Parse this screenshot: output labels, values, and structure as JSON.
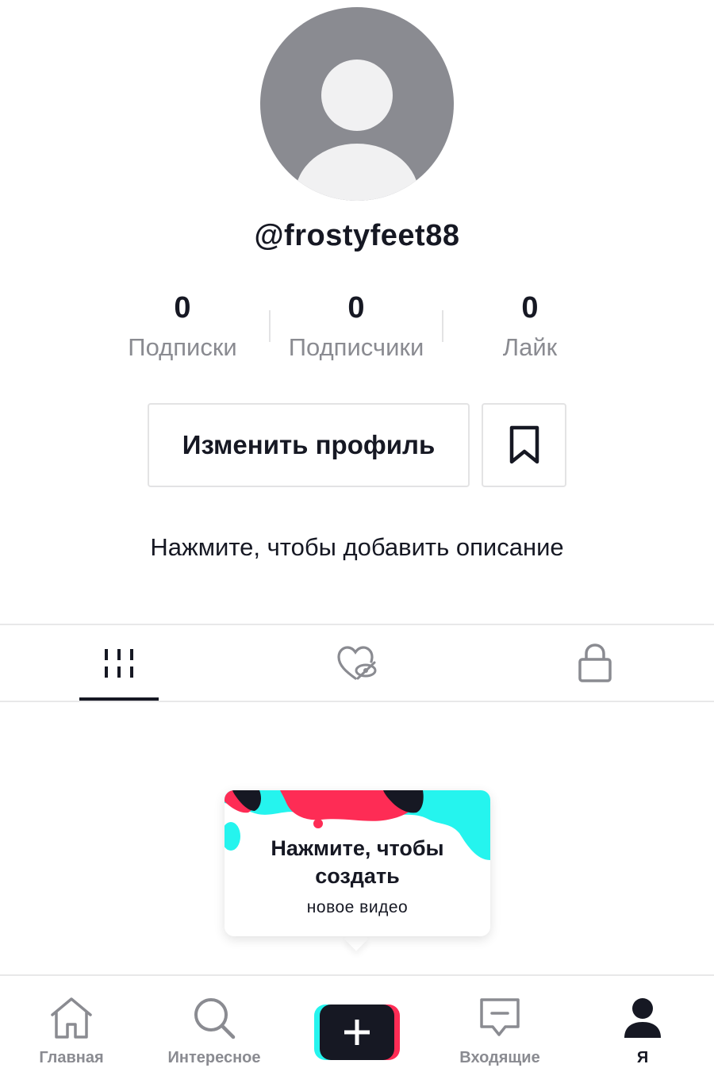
{
  "profile": {
    "username": "@frostyfeet88",
    "bio_placeholder": "Нажмите, чтобы добавить описание"
  },
  "stats": [
    {
      "value": "0",
      "label": "Подписки"
    },
    {
      "value": "0",
      "label": "Подписчики"
    },
    {
      "value": "0",
      "label": "Лайк"
    }
  ],
  "actions": {
    "edit_profile_label": "Изменить профиль",
    "bookmark_icon": "bookmark-icon"
  },
  "tabs": [
    {
      "icon": "grid-icon",
      "active": true
    },
    {
      "icon": "liked-hidden-icon",
      "active": false
    },
    {
      "icon": "lock-icon",
      "active": false
    }
  ],
  "create_tooltip": {
    "title_line1": "Нажмите, чтобы",
    "title_line2": "создать",
    "subtitle": "новое видео"
  },
  "bottom_nav": [
    {
      "label": "Главная",
      "icon": "home-icon",
      "active": false
    },
    {
      "label": "Интересное",
      "icon": "search-icon",
      "active": false
    },
    {
      "label": "",
      "icon": "plus-icon",
      "active": false
    },
    {
      "label": "Входящие",
      "icon": "inbox-icon",
      "active": false
    },
    {
      "label": "Я",
      "icon": "profile-icon",
      "active": true
    }
  ],
  "colors": {
    "text": "#161823",
    "muted": "#8a8b91",
    "divider": "#e3e3e4",
    "cyan": "#25f4ee",
    "red": "#fe2c55"
  }
}
